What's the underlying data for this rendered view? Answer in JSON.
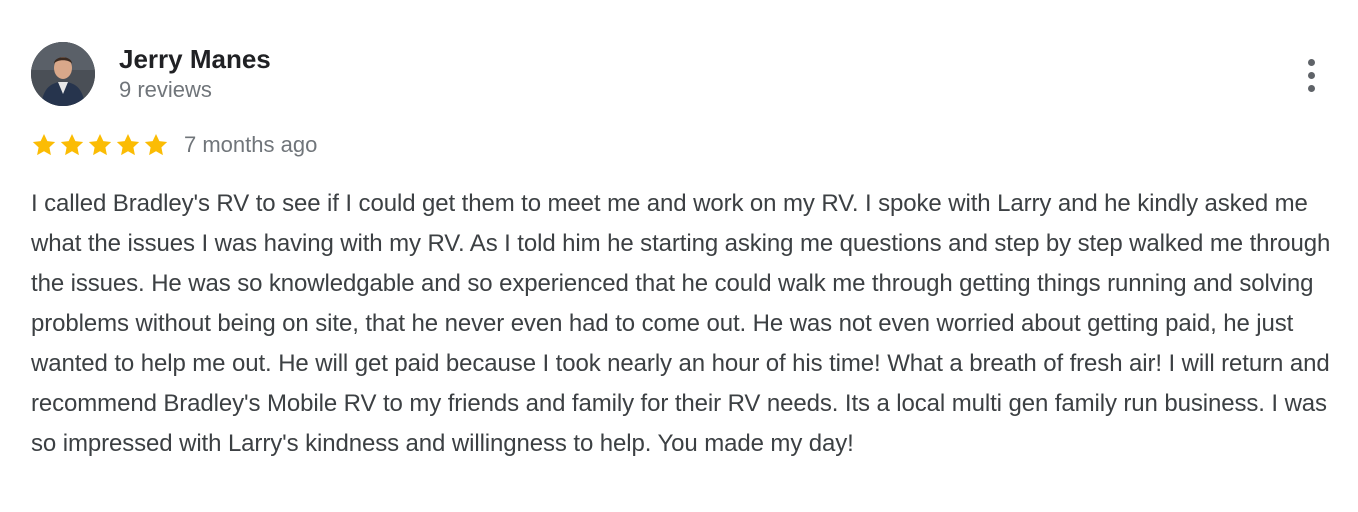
{
  "reviewer": {
    "name": "Jerry Manes",
    "review_count": "9 reviews",
    "avatar_icon": "person-avatar-icon"
  },
  "rating": {
    "stars": 5,
    "max_stars": 5,
    "star_color": "#fbbc04",
    "date": "7 months ago"
  },
  "menu": {
    "icon": "more-vertical-icon"
  },
  "review": {
    "text": "I called Bradley's RV to see if I could get them to meet me and work on my RV. I spoke with Larry and he kindly asked me what the issues I was having with my RV. As I told him he starting asking me questions and step by step walked me through the issues. He was so knowledgable and so experienced that he could walk me through getting things running and solving problems without being on site, that he never even had to come out. He was not even worried about getting paid, he just wanted to help me out. He will get paid because I took nearly an hour of his time! What a breath of fresh air! I will return and recommend Bradley's Mobile RV to my friends and family for their RV needs. Its a local multi gen family run business. I was so impressed with Larry's kindness and willingness to help. You made my day!"
  }
}
